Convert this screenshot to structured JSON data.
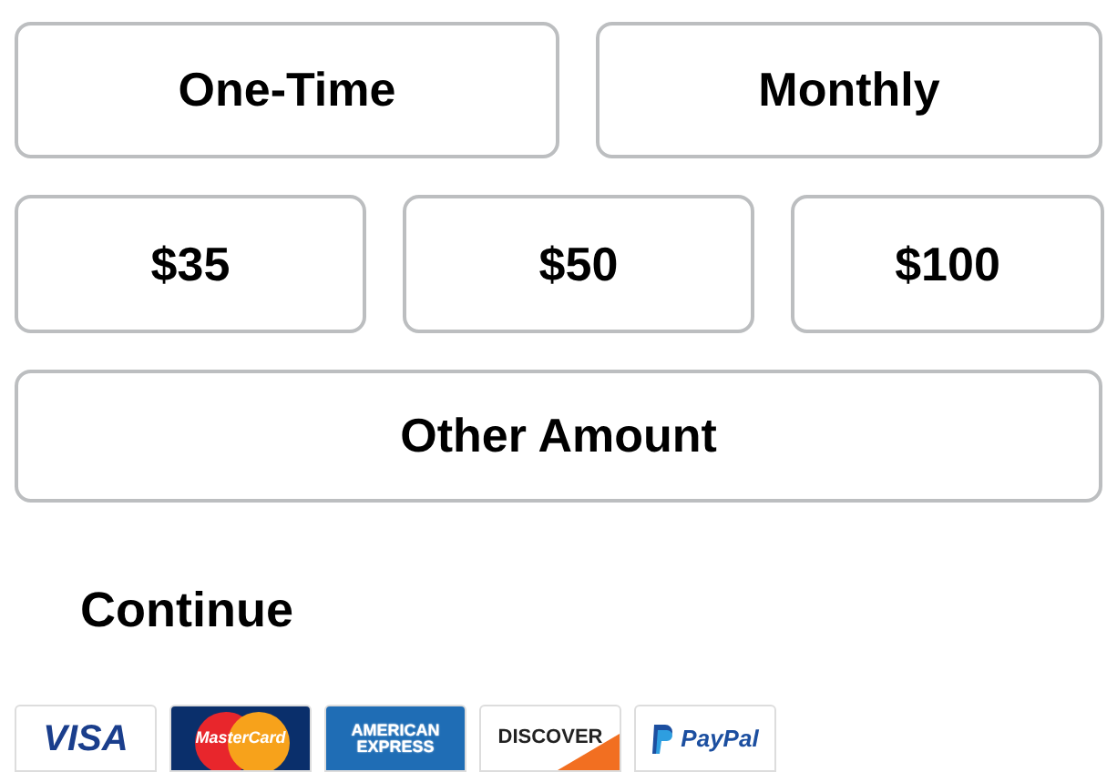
{
  "frequencies": [
    {
      "label": "One-Time",
      "selected": false
    },
    {
      "label": "Monthly",
      "selected": false
    }
  ],
  "amounts": [
    {
      "label": "$35",
      "selected": false
    },
    {
      "label": "$50",
      "selected": false
    },
    {
      "label": "$100",
      "selected": false
    },
    {
      "label": "Other Amount",
      "selected": false
    }
  ],
  "continue_button": {
    "label": "Continue"
  },
  "payment_methods": [
    {
      "kind": "visa",
      "label": "VISA"
    },
    {
      "kind": "mastercard",
      "label": "MasterCard"
    },
    {
      "kind": "amex",
      "label": "AMERICAN EXPRESS"
    },
    {
      "kind": "discover",
      "label": "DISCOVER"
    },
    {
      "kind": "paypal",
      "label": "PayPal"
    }
  ]
}
